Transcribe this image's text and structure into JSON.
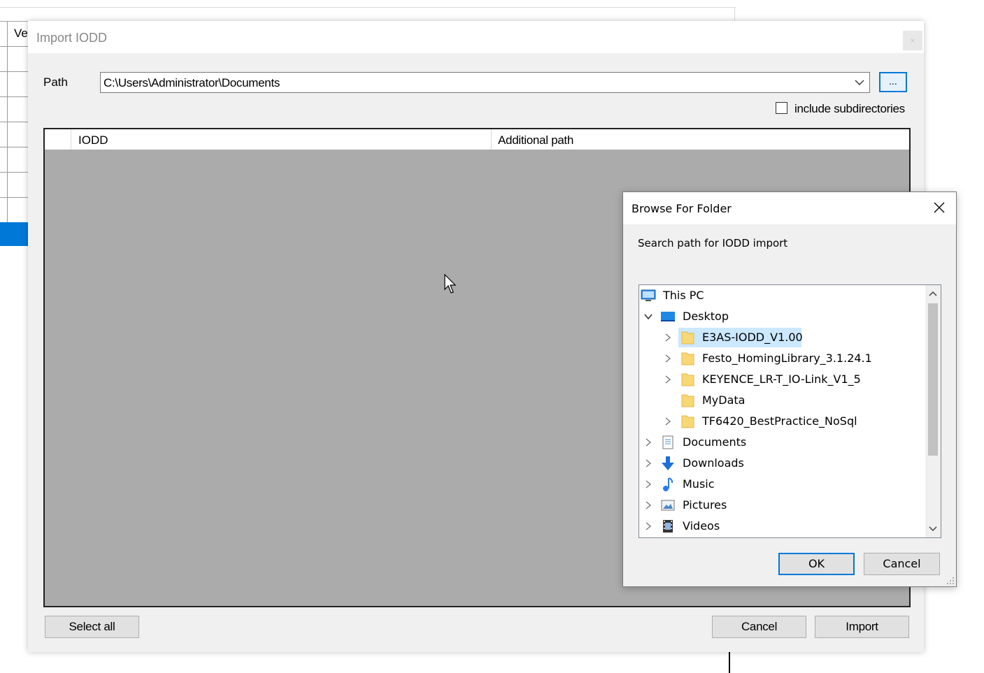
{
  "background_app": {
    "column_header": "Ve"
  },
  "import_dialog": {
    "title": "Import IODD",
    "close_label": "×",
    "path_label": "Path",
    "path_value": "C:\\Users\\Administrator\\Documents",
    "browse_label": "...",
    "include_subdirectories_label": "include subdirectories",
    "include_subdirectories_checked": false,
    "grid": {
      "columns": [
        "IODD",
        "Additional path"
      ],
      "rows": []
    },
    "buttons": {
      "select_all": "Select all",
      "cancel": "Cancel",
      "import": "Import"
    }
  },
  "browse_dialog": {
    "title": "Browse For Folder",
    "description": "Search path for IODD import",
    "tree": [
      {
        "label": "This PC",
        "icon": "this-pc-icon",
        "level": 0,
        "expander": "none"
      },
      {
        "label": "Desktop",
        "icon": "desktop-icon",
        "level": 1,
        "expander": "expanded"
      },
      {
        "label": "E3AS-IODD_V1.00",
        "icon": "folder-icon",
        "level": 2,
        "expander": "collapsed",
        "selected": true
      },
      {
        "label": "Festo_HomingLibrary_3.1.24.1",
        "icon": "folder-icon",
        "level": 2,
        "expander": "collapsed"
      },
      {
        "label": "KEYENCE_LR-T_IO-Link_V1_5",
        "icon": "folder-icon",
        "level": 2,
        "expander": "collapsed"
      },
      {
        "label": "MyData",
        "icon": "folder-icon",
        "level": 2,
        "expander": "none"
      },
      {
        "label": "TF6420_BestPractice_NoSql",
        "icon": "folder-icon",
        "level": 2,
        "expander": "collapsed"
      },
      {
        "label": "Documents",
        "icon": "documents-icon",
        "level": 1,
        "expander": "collapsed"
      },
      {
        "label": "Downloads",
        "icon": "downloads-icon",
        "level": 1,
        "expander": "collapsed"
      },
      {
        "label": "Music",
        "icon": "music-icon",
        "level": 1,
        "expander": "collapsed"
      },
      {
        "label": "Pictures",
        "icon": "pictures-icon",
        "level": 1,
        "expander": "collapsed"
      },
      {
        "label": "Videos",
        "icon": "videos-icon",
        "level": 1,
        "expander": "collapsed"
      }
    ],
    "buttons": {
      "ok": "OK",
      "cancel": "Cancel"
    }
  },
  "colors": {
    "accent": "#0078d7",
    "selection": "#cce8ff",
    "grid_background": "#ababab"
  }
}
